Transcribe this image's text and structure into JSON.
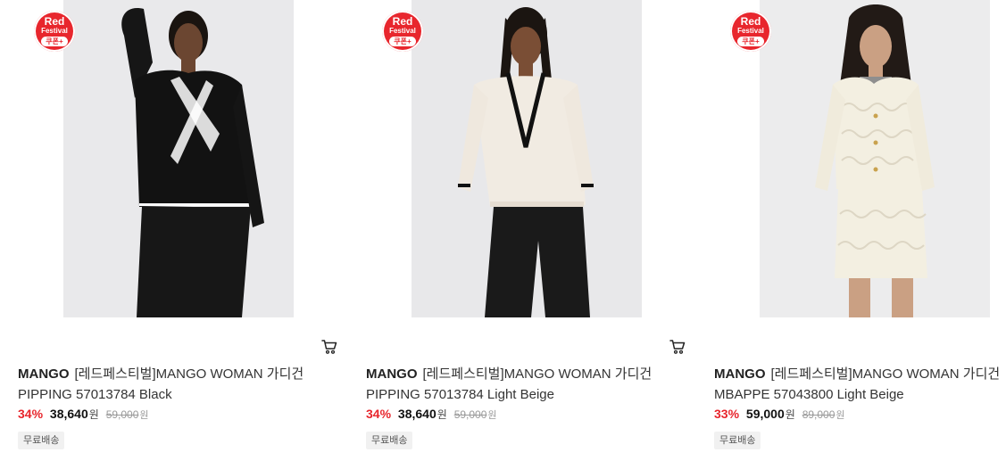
{
  "products": [
    {
      "badge": {
        "line1": "Red",
        "line2": "Festival",
        "line3": "쿠폰+"
      },
      "brand": "MANGO",
      "name": "[레드페스티벌]MANGO WOMAN 가디건 PIPPING 57013784 Black",
      "discount": "34%",
      "price": "38,640",
      "currency": "원",
      "original_price": "59,000",
      "original_currency": "원",
      "tag": "무료배송",
      "has_cart": true
    },
    {
      "badge": {
        "line1": "Red",
        "line2": "Festival",
        "line3": "쿠폰+"
      },
      "brand": "MANGO",
      "name": "[레드페스티벌]MANGO WOMAN 가디건 PIPPING 57013784 Light Beige",
      "discount": "34%",
      "price": "38,640",
      "currency": "원",
      "original_price": "59,000",
      "original_currency": "원",
      "tag": "무료배송",
      "has_cart": true
    },
    {
      "badge": {
        "line1": "Red",
        "line2": "Festival",
        "line3": "쿠폰+"
      },
      "brand": "MANGO",
      "name": "[레드페스티벌]MANGO WOMAN 가디건 MBAPPE 57043800 Light Beige",
      "discount": "33%",
      "price": "59,000",
      "currency": "원",
      "original_price": "89,000",
      "original_currency": "원",
      "tag": "무료배송",
      "has_cart": false
    }
  ],
  "icons": {
    "cart": "cart-icon"
  },
  "colors": {
    "accent_red": "#e8262d",
    "discount_red": "#e8262d",
    "tag_bg": "#f1f1f1"
  }
}
